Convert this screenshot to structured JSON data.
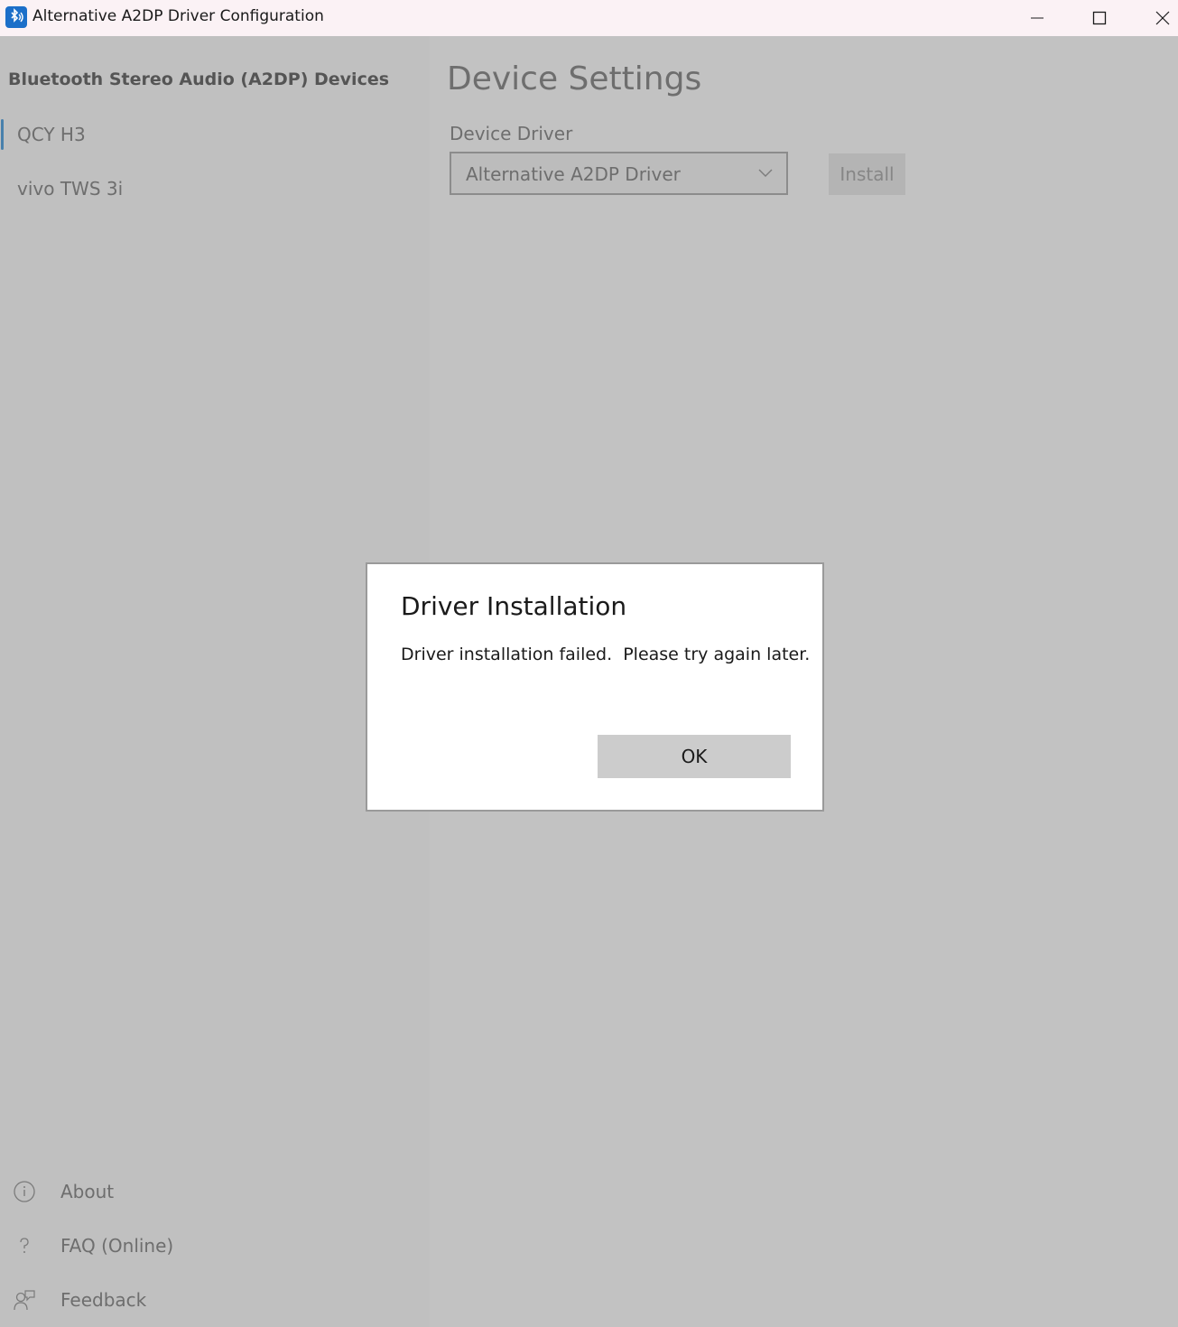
{
  "window": {
    "title": "Alternative A2DP Driver Configuration",
    "icon": "bluetooth-audio-icon"
  },
  "sidebar": {
    "heading": "Bluetooth Stereo Audio (A2DP) Devices",
    "devices": [
      {
        "label": "QCY H3",
        "selected": true
      },
      {
        "label": "vivo TWS 3i",
        "selected": false
      }
    ],
    "footer": [
      {
        "label": "About",
        "icon": "info-icon"
      },
      {
        "label": "FAQ (Online)",
        "icon": "question-icon"
      },
      {
        "label": "Feedback",
        "icon": "feedback-icon"
      }
    ]
  },
  "main": {
    "title": "Device Settings",
    "driver_label": "Device Driver",
    "driver_value": "Alternative A2DP Driver",
    "install_label": "Install"
  },
  "dialog": {
    "title": "Driver Installation",
    "message": "Driver installation failed.  Please try again later.",
    "ok_label": "OK"
  },
  "colors": {
    "accent": "#5aa0d8",
    "titlebar": "#fbf2f5"
  }
}
